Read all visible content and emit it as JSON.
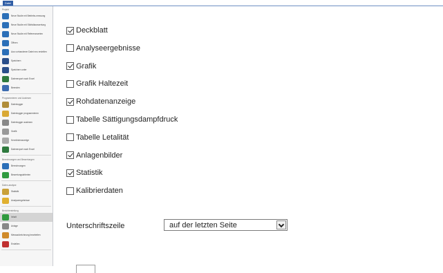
{
  "topbar": {
    "app_button": "Datei"
  },
  "sidebar": {
    "sections": [
      {
        "title": "Projekt",
        "items": [
          {
            "label": "Neue Studie mit Betriebs-messung",
            "icon": "globe-icon",
            "color": "#2b6fb8"
          },
          {
            "label": "Neue Studie mit Störfallauswertung",
            "icon": "globe-icon",
            "color": "#2b6fb8"
          },
          {
            "label": "Neue Studie mit Referenzwerten",
            "icon": "globe-icon",
            "color": "#2b6fb8"
          },
          {
            "label": "Öffnen",
            "icon": "open-globe-icon",
            "color": "#2b6fb8"
          },
          {
            "label": "Aus vorhandener Datei neu erstellen",
            "icon": "globe-icon",
            "color": "#2b6fb8"
          },
          {
            "label": "Speichern",
            "icon": "save-icon",
            "color": "#2b4f8a"
          },
          {
            "label": "Speichern unter",
            "icon": "save-as-icon",
            "color": "#2b4f8a"
          },
          {
            "label": "Datenexport nach Excel",
            "icon": "excel-icon",
            "color": "#2f7a3e"
          },
          {
            "label": "Beenden",
            "icon": "exit-icon",
            "color": "#3d6cb0"
          }
        ]
      },
      {
        "title": "Programmieren und Auslesen",
        "items": [
          {
            "label": "Datenlogger",
            "icon": "logger-icon",
            "color": "#b08d3a"
          },
          {
            "label": "Datenlogger programmieren",
            "icon": "program-icon",
            "color": "#d9a935"
          },
          {
            "label": "Datenlogger auslesen",
            "icon": "readout-icon",
            "color": "#888888"
          },
          {
            "label": "Grafik",
            "icon": "graph-icon",
            "color": "#999999"
          },
          {
            "label": "Kennlinienanzeige",
            "icon": "curve-icon",
            "color": "#aaaaaa"
          },
          {
            "label": "Datenexport nach Excel",
            "icon": "excel-icon",
            "color": "#2f7a3e"
          }
        ]
      },
      {
        "title": "Berechnungen und Bewertungen",
        "items": [
          {
            "label": "Berechnungen",
            "icon": "calc-icon",
            "color": "#2b6fb8"
          },
          {
            "label": "Bewertungskriterien",
            "icon": "check-icon",
            "color": "#2f9a3e"
          }
        ]
      },
      {
        "title": "Daten-analyse",
        "items": [
          {
            "label": "Statistik",
            "icon": "stats-icon",
            "color": "#c9a13a"
          },
          {
            "label": "Analyseergebnisse",
            "icon": "analysis-icon",
            "color": "#e0b030"
          }
        ]
      },
      {
        "title": "Berichterstellung",
        "items": [
          {
            "label": "Inhalt",
            "icon": "content-check-icon",
            "color": "#2f9a3e",
            "selected": true
          },
          {
            "label": "Anlage",
            "icon": "attachment-icon",
            "color": "#888888"
          },
          {
            "label": "Messaufzeichnung bearbeiten",
            "icon": "edit-record-icon",
            "color": "#d08a2a"
          },
          {
            "label": "Erstellen",
            "icon": "print-icon",
            "color": "#c03030"
          }
        ]
      }
    ]
  },
  "content": {
    "checkboxes": [
      {
        "label": "Deckblatt",
        "checked": true
      },
      {
        "label": "Analyseergebnisse",
        "checked": false
      },
      {
        "label": "Grafik",
        "checked": true
      },
      {
        "label": "Grafik Haltezeit",
        "checked": false
      },
      {
        "label": "Rohdatenanzeige",
        "checked": true
      },
      {
        "label": "Tabelle Sättigungsdampfdruck",
        "checked": false
      },
      {
        "label": "Tabelle Letalität",
        "checked": false
      },
      {
        "label": "Anlagenbilder",
        "checked": true
      },
      {
        "label": "Statistik",
        "checked": true
      },
      {
        "label": "Kalibrierdaten",
        "checked": false
      }
    ],
    "signature": {
      "label": "Unterschriftszeile",
      "selected": "auf der letzten Seite"
    }
  }
}
